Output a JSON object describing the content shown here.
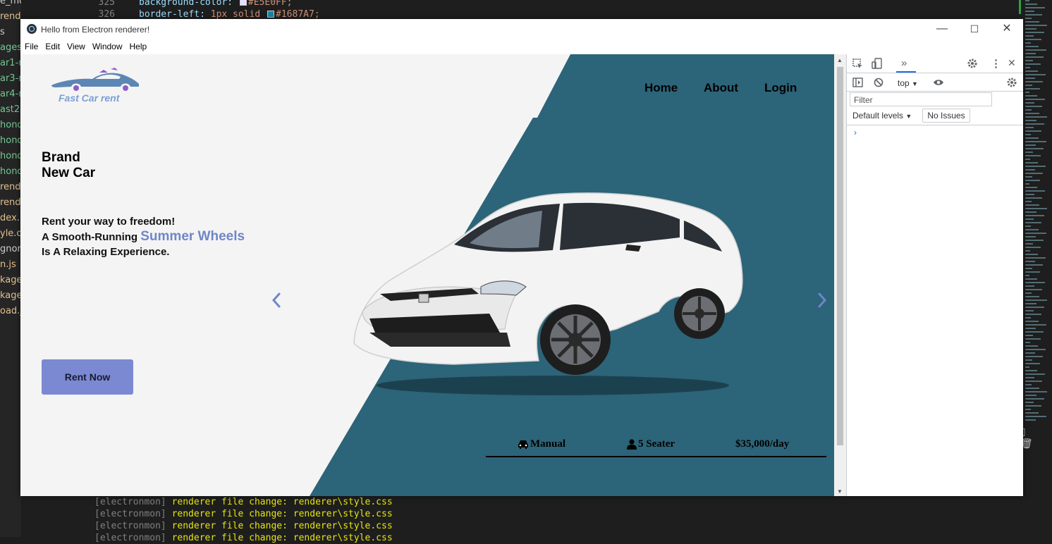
{
  "editor": {
    "explorer_items": [
      {
        "label": "e_modules",
        "color": "gray"
      },
      {
        "label": "renderer",
        "color": "yellow"
      },
      {
        "label": "s",
        "color": "gray"
      },
      {
        "label": "ages",
        "color": "green"
      },
      {
        "label": "ar1-r",
        "color": "green"
      },
      {
        "label": "ar3-r",
        "color": "green"
      },
      {
        "label": "ar4-r",
        "color": "green"
      },
      {
        "label": "ast2-r",
        "color": "green"
      },
      {
        "label": "honda",
        "color": "green"
      },
      {
        "label": "honda",
        "color": "green"
      },
      {
        "label": "honda",
        "color": "green"
      },
      {
        "label": "honda",
        "color": "green"
      },
      {
        "label": "rendere",
        "color": "yellow"
      },
      {
        "label": "rende",
        "color": "yellow"
      },
      {
        "label": "dex.ht",
        "color": "yellow"
      },
      {
        "label": "yle.css",
        "color": "yellow"
      },
      {
        "label": "gnore",
        "color": "gray"
      },
      {
        "label": "n.js",
        "color": "yellow"
      },
      {
        "label": "kage-",
        "color": "yellow"
      },
      {
        "label": "kage.",
        "color": "yellow"
      },
      {
        "label": "oad.js",
        "color": "yellow"
      }
    ],
    "line_numbers": [
      "325",
      "326"
    ],
    "code_lines": [
      {
        "prop": "background-color:",
        "swatch": "#E5E0FF",
        "val": "#E5E0FF;"
      },
      {
        "prop": "border-left:",
        "pre": " 1px solid ",
        "swatch": "#1687A7",
        "val": "#1687A7;"
      }
    ],
    "terminal": [
      {
        "tag": "[electronmon]",
        "msg": "renderer file change: renderer\\style.css"
      },
      {
        "tag": "[electronmon]",
        "msg": "renderer file change: renderer\\style.css"
      },
      {
        "tag": "[electronmon]",
        "msg": "renderer file change: renderer\\style.css"
      },
      {
        "tag": "[electronmon]",
        "msg": "renderer file change: renderer\\style.css"
      }
    ]
  },
  "window": {
    "title": "Hello from Electron renderer!",
    "menu": [
      "File",
      "Edit",
      "View",
      "Window",
      "Help"
    ],
    "controls": {
      "minimize": "—",
      "maximize": "☐",
      "close": "✕"
    }
  },
  "site": {
    "logo_text": "Fast Car rent",
    "nav": [
      "Home",
      "About",
      "Login"
    ],
    "hero": {
      "line1": "Brand",
      "line2": "New Car"
    },
    "tagline": {
      "line1": "Rent your way to freedom!",
      "line2_prefix": "A Smooth-Running ",
      "line2_accent": "Summer Wheels",
      "line3": "Is A Relaxing Experience."
    },
    "cta": "Rent Now",
    "prev_arrow": "‹",
    "next_arrow": "›",
    "specs": {
      "transmission": "Manual",
      "seats": "5 Seater",
      "price": "$35,000/day"
    },
    "colors": {
      "accent": "#7B89D3",
      "teal": "#2C6479",
      "page_bg": "#F4F4F4"
    }
  },
  "devtools": {
    "more_tabs": "»",
    "context": "top",
    "filter_placeholder": "Filter",
    "levels": "Default levels",
    "issues": "No Issues",
    "prompt": "›"
  }
}
